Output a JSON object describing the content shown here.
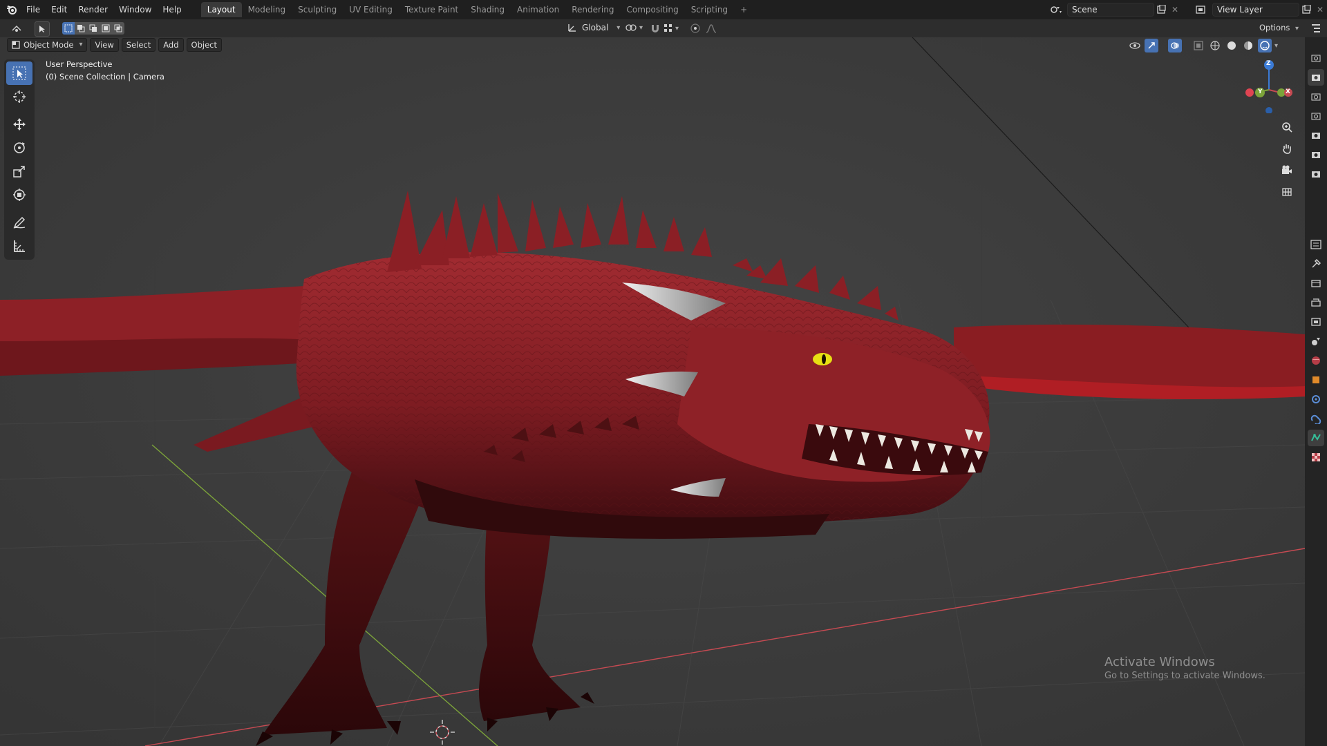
{
  "menu": {
    "items": [
      "File",
      "Edit",
      "Render",
      "Window",
      "Help"
    ]
  },
  "workspaces": {
    "tabs": [
      "Layout",
      "Modeling",
      "Sculpting",
      "UV Editing",
      "Texture Paint",
      "Shading",
      "Animation",
      "Rendering",
      "Compositing",
      "Scripting"
    ],
    "active": "Layout",
    "add": "+"
  },
  "scene": {
    "name": "Scene"
  },
  "view_layer": {
    "name": "View Layer"
  },
  "header2": {
    "orientation": "Global",
    "options": "Options"
  },
  "viewport_header": {
    "mode": "Object Mode",
    "menus": [
      "View",
      "Select",
      "Add",
      "Object"
    ]
  },
  "overlay": {
    "perspective": "User Perspective",
    "collection": "(0) Scene Collection | Camera"
  },
  "gizmo": {
    "z": "Z",
    "y": "Y",
    "x": "X"
  },
  "watermark": {
    "title": "Activate Windows",
    "subtitle": "Go to Settings to activate Windows."
  },
  "colors": {
    "accent": "#4772b3",
    "topbar": "#1f1f1f",
    "viewport": "#3c3c3c",
    "dragon": "#8f2226",
    "axis_x": "#c64a52",
    "axis_y": "#7ca33a"
  }
}
